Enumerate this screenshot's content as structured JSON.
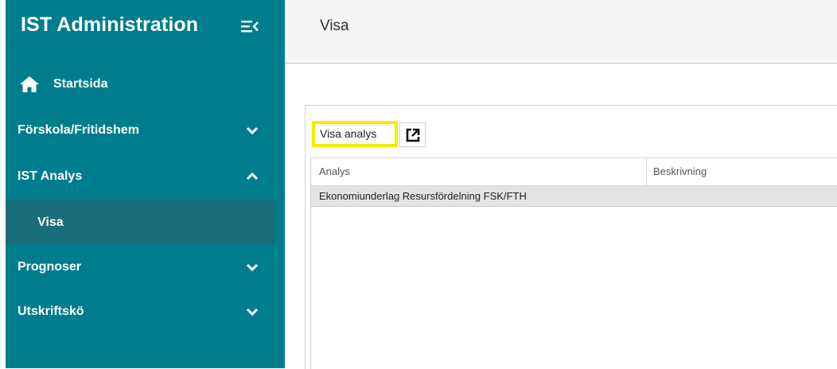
{
  "app": {
    "title": "IST Administration"
  },
  "sidebar": {
    "home": {
      "label": "Startsida",
      "icon": "home-icon"
    },
    "items": [
      {
        "label": "Förskola/Fritidshem",
        "expanded": false,
        "icon": "chevron-down-icon"
      },
      {
        "label": "IST Analys",
        "expanded": true,
        "icon": "chevron-up-icon"
      },
      {
        "label": "Prognoser",
        "expanded": false,
        "icon": "chevron-down-icon"
      },
      {
        "label": "Utskriftskö",
        "expanded": false,
        "icon": "chevron-down-icon"
      }
    ],
    "subitem": {
      "label": "Visa",
      "active": true
    }
  },
  "header": {
    "title": "Visa"
  },
  "toolbar": {
    "visa_analys_label": "Visa analys",
    "external_icon": "external-link-icon",
    "highlight_color": "#f5ec00"
  },
  "table": {
    "columns": [
      "Analys",
      "Beskrivning"
    ],
    "rows": [
      {
        "analys": "Ekonomiunderlag Resursfördelning FSK/FTH",
        "beskrivning": ""
      }
    ]
  },
  "colors": {
    "sidebar_bg": "#007d8c",
    "sidebar_active_bg": "#196d7b",
    "topbar_bg": "#f5f5f5",
    "row_selected_bg": "#e4e4e4"
  }
}
